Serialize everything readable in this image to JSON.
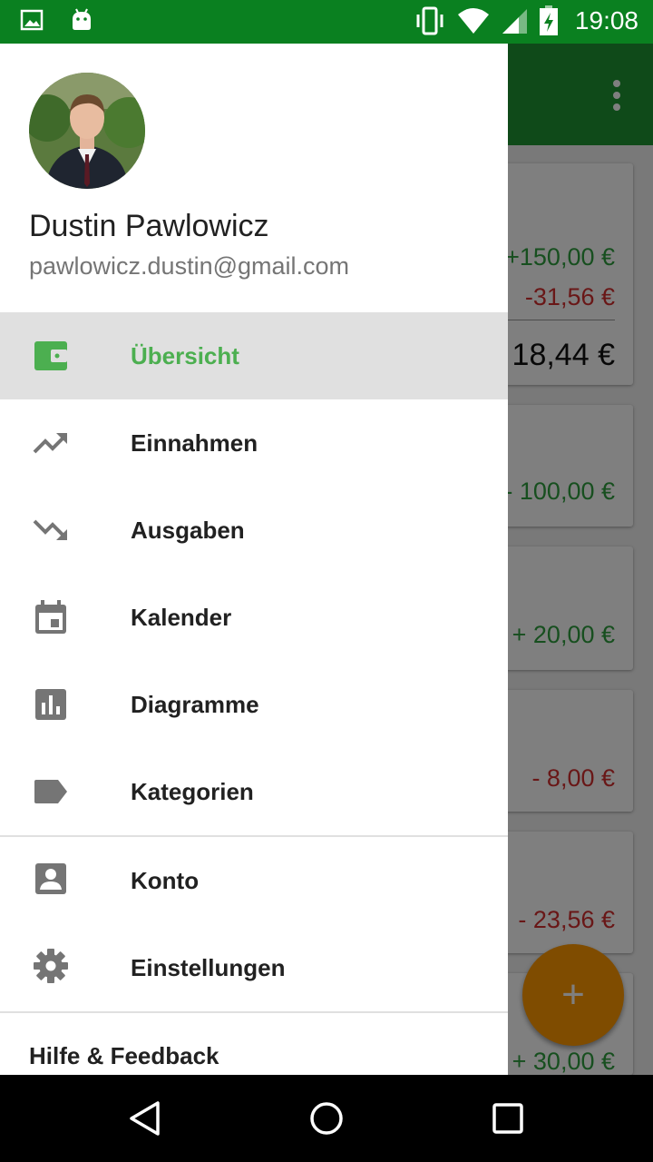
{
  "status_bar": {
    "time": "19:08",
    "left_icons": [
      "image-icon",
      "android-icon"
    ],
    "right_icons": [
      "vibrate-icon",
      "wifi-icon",
      "signal-icon",
      "battery-charging-icon"
    ]
  },
  "background": {
    "appbar_color": "#1f9432",
    "overview_card": {
      "income": "+150,00 €",
      "expense": "-31,56 €",
      "total": "18,44 €"
    },
    "transactions": [
      {
        "amount": "- 100,00 €",
        "type": "income"
      },
      {
        "amount": "+ 20,00 €",
        "type": "income"
      },
      {
        "amount": "- 8,00 €",
        "type": "expense"
      },
      {
        "amount": "- 23,56 €",
        "type": "expense"
      },
      {
        "amount": "+ 30,00 €",
        "type": "income"
      }
    ],
    "fab_icon": "+"
  },
  "drawer": {
    "user": {
      "name": "Dustin Pawlowicz",
      "email": "pawlowicz.dustin@gmail.com"
    },
    "items": [
      {
        "label": "Übersicht",
        "icon": "wallet-icon",
        "active": true
      },
      {
        "label": "Einnahmen",
        "icon": "trending-up-icon",
        "active": false
      },
      {
        "label": "Ausgaben",
        "icon": "trending-down-icon",
        "active": false
      },
      {
        "label": "Kalender",
        "icon": "calendar-icon",
        "active": false
      },
      {
        "label": "Diagramme",
        "icon": "bar-chart-icon",
        "active": false
      },
      {
        "label": "Kategorien",
        "icon": "label-tag-icon",
        "active": false
      }
    ],
    "secondary_items": [
      {
        "label": "Konto",
        "icon": "account-box-icon"
      },
      {
        "label": "Einstellungen",
        "icon": "settings-gear-icon"
      }
    ],
    "help_label": "Hilfe & Feedback"
  },
  "colors": {
    "accent": "#4caf50",
    "status_bar": "#0a8020",
    "fab": "#ff9800",
    "income": "#2e9e3e",
    "expense": "#d32f2f"
  }
}
